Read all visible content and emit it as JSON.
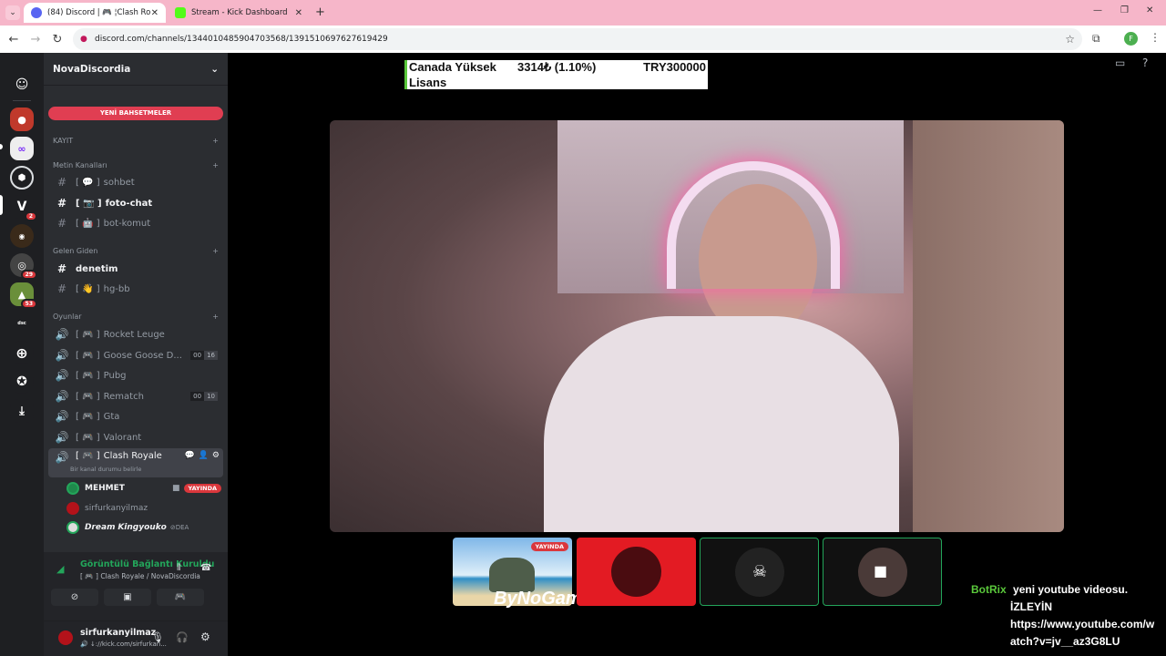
{
  "browser": {
    "tabs": [
      {
        "label": "(84) Discord | 🎮 ¦Clash Ro",
        "active": true
      },
      {
        "label": "Stream - Kick Dashboard",
        "active": false
      }
    ],
    "url": "discord.com/channels/1344010485904703568/1391510697627619429"
  },
  "server": {
    "name": "NovaDiscordia",
    "boost_label": "YENİ BAHSETMELER",
    "categories": {
      "kayit": "KAYIT",
      "metin": "Metin Kanalları",
      "gelen": "Gelen Giden",
      "oyunlar": "Oyunlar"
    },
    "text_channels": [
      {
        "bracket": "[ 💬 ]",
        "name": "sohbet"
      },
      {
        "bracket": "[ 📷 ]",
        "name": "foto-chat"
      },
      {
        "bracket": "[ 🤖 ]",
        "name": "bot-komut"
      }
    ],
    "denetim": "denetim",
    "hg_bb": {
      "bracket": "[ 👋 ]",
      "name": "hg-bb"
    },
    "voice_channels": [
      {
        "bracket": "[ 🎮 ]",
        "name": "Rocket Leuge"
      },
      {
        "bracket": "[ 🎮 ]",
        "name": "Goose Goose D...",
        "c1": "00",
        "c2": "16"
      },
      {
        "bracket": "[ 🎮 ]",
        "name": "Pubg"
      },
      {
        "bracket": "[ 🎮 ]",
        "name": "Rematch",
        "c1": "00",
        "c2": "10"
      },
      {
        "bracket": "[ 🎮 ]",
        "name": "Gta"
      },
      {
        "bracket": "[ 🎮 ]",
        "name": "Valorant"
      }
    ],
    "selected_channel": {
      "bracket": "[ 🎮 ]",
      "name": "Clash Royale",
      "status": "Bir kanal durumu belirle"
    },
    "voice_users": [
      {
        "name": "MEHMET",
        "live": "YAYINDA"
      },
      {
        "name": "sirfurkanyilmaz"
      },
      {
        "name": "𝘿𝙧𝙚𝙖𝙢 𝙆𝙞𝙣𝙜𝙮𝙤𝙪𝙠𝙤",
        "extra": "DEA"
      }
    ],
    "server_badges": {
      "s4": "2",
      "s6": "29",
      "s7": "53"
    }
  },
  "voice_panel": {
    "status": "Görüntülü Bağlantı Kuruldu",
    "subtitle": "[ 🎮 ] Clash Royale / NovaDiscordia"
  },
  "user_panel": {
    "username": "sirfurkanyilmaz",
    "status": "🔊 ↓://kick.com/sirfurkan..."
  },
  "stream_overlay": {
    "line1_left": "Canada Yüksek",
    "line1_mid": "3314₺ (1.10%)",
    "line1_right": "TRY300000",
    "line2": "Lisans"
  },
  "thumbs": {
    "live": "YAYINDA",
    "watermark": "ByNoGame"
  },
  "botrix": {
    "name": "BotRix",
    "lines": [
      "yeni youtube videosu.",
      "İZLEYİN",
      "https://www.youtube.com/w",
      "atch?v=jv__az3G8LU"
    ]
  }
}
